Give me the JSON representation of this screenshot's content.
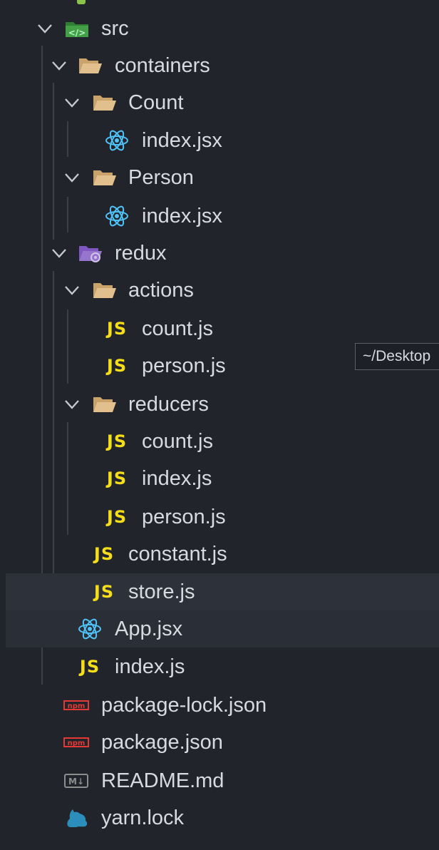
{
  "tree": {
    "src": "src",
    "containers": "containers",
    "count_folder": "Count",
    "count_index": "index.jsx",
    "person_folder": "Person",
    "person_index": "index.jsx",
    "redux": "redux",
    "actions": "actions",
    "actions_count": "count.js",
    "actions_person": "person.js",
    "reducers": "reducers",
    "reducers_count": "count.js",
    "reducers_index": "index.js",
    "reducers_person": "person.js",
    "constant": "constant.js",
    "store": "store.js",
    "app": "App.jsx",
    "src_index": "index.js",
    "package_lock": "package-lock.json",
    "package": "package.json",
    "readme": "README.md",
    "yarn": "yarn.lock"
  },
  "tooltip": "~/Desktop",
  "icons": {
    "js_text": "JS",
    "npm_text": "npm",
    "md_text": "M↓"
  },
  "colors": {
    "background": "#21252b",
    "text": "#d7dae0",
    "folder": "#e2c08d",
    "react": "#4fc3f7",
    "js": "#f5de19",
    "npm": "#e53935",
    "src_folder": "#43a047",
    "redux_folder": "#9575cd"
  }
}
